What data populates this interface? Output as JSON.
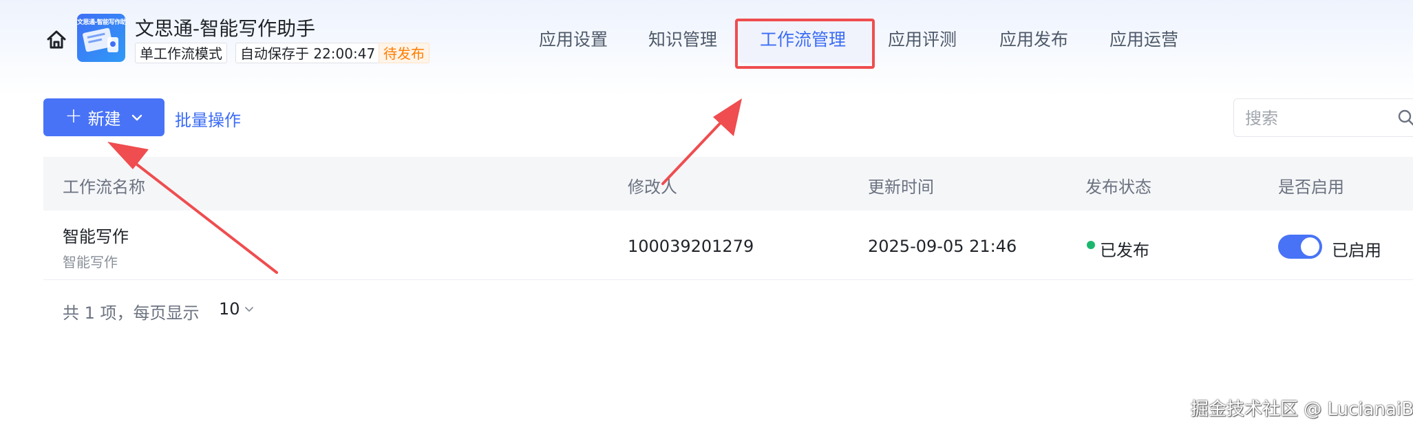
{
  "header": {
    "home_icon": "home-icon",
    "app_logo_text": "文思通-智能写作助",
    "app_title": "文思通-智能写作助手",
    "tags": {
      "mode": "单工作流模式",
      "autosave": "自动保存于 22:00:47",
      "status": "待发布"
    }
  },
  "nav": {
    "tabs": [
      {
        "label": "应用设置"
      },
      {
        "label": "知识管理"
      },
      {
        "label": "工作流管理",
        "active": true
      },
      {
        "label": "应用评测"
      },
      {
        "label": "应用发布"
      },
      {
        "label": "应用运营"
      }
    ]
  },
  "toolbar": {
    "new_button": {
      "icon": "plus-icon",
      "label": "新建",
      "chevron": "chevron-down-icon"
    },
    "batch_label": "批量操作",
    "search_placeholder": "搜索",
    "search_icon": "search-icon"
  },
  "table": {
    "columns": [
      "工作流名称",
      "修改人",
      "更新时间",
      "发布状态",
      "是否启用"
    ],
    "rows": [
      {
        "name": "智能写作",
        "description": "智能写作",
        "modifier": "100039201279",
        "updated": "2025-09-05 21:46",
        "status": "已发布",
        "enabled": true,
        "enabled_label": "已启用"
      }
    ]
  },
  "pagination": {
    "summary": "共 1 项，每页显示",
    "page_size": "10"
  },
  "colors": {
    "primary": "#4873f6",
    "active_tab": "#3b6cf6",
    "pending": "#ff7d00",
    "published_dot": "#1bb76e",
    "annotation": "#ef4d4f"
  },
  "watermark": "掘金技术社区 @ LucianaiB"
}
